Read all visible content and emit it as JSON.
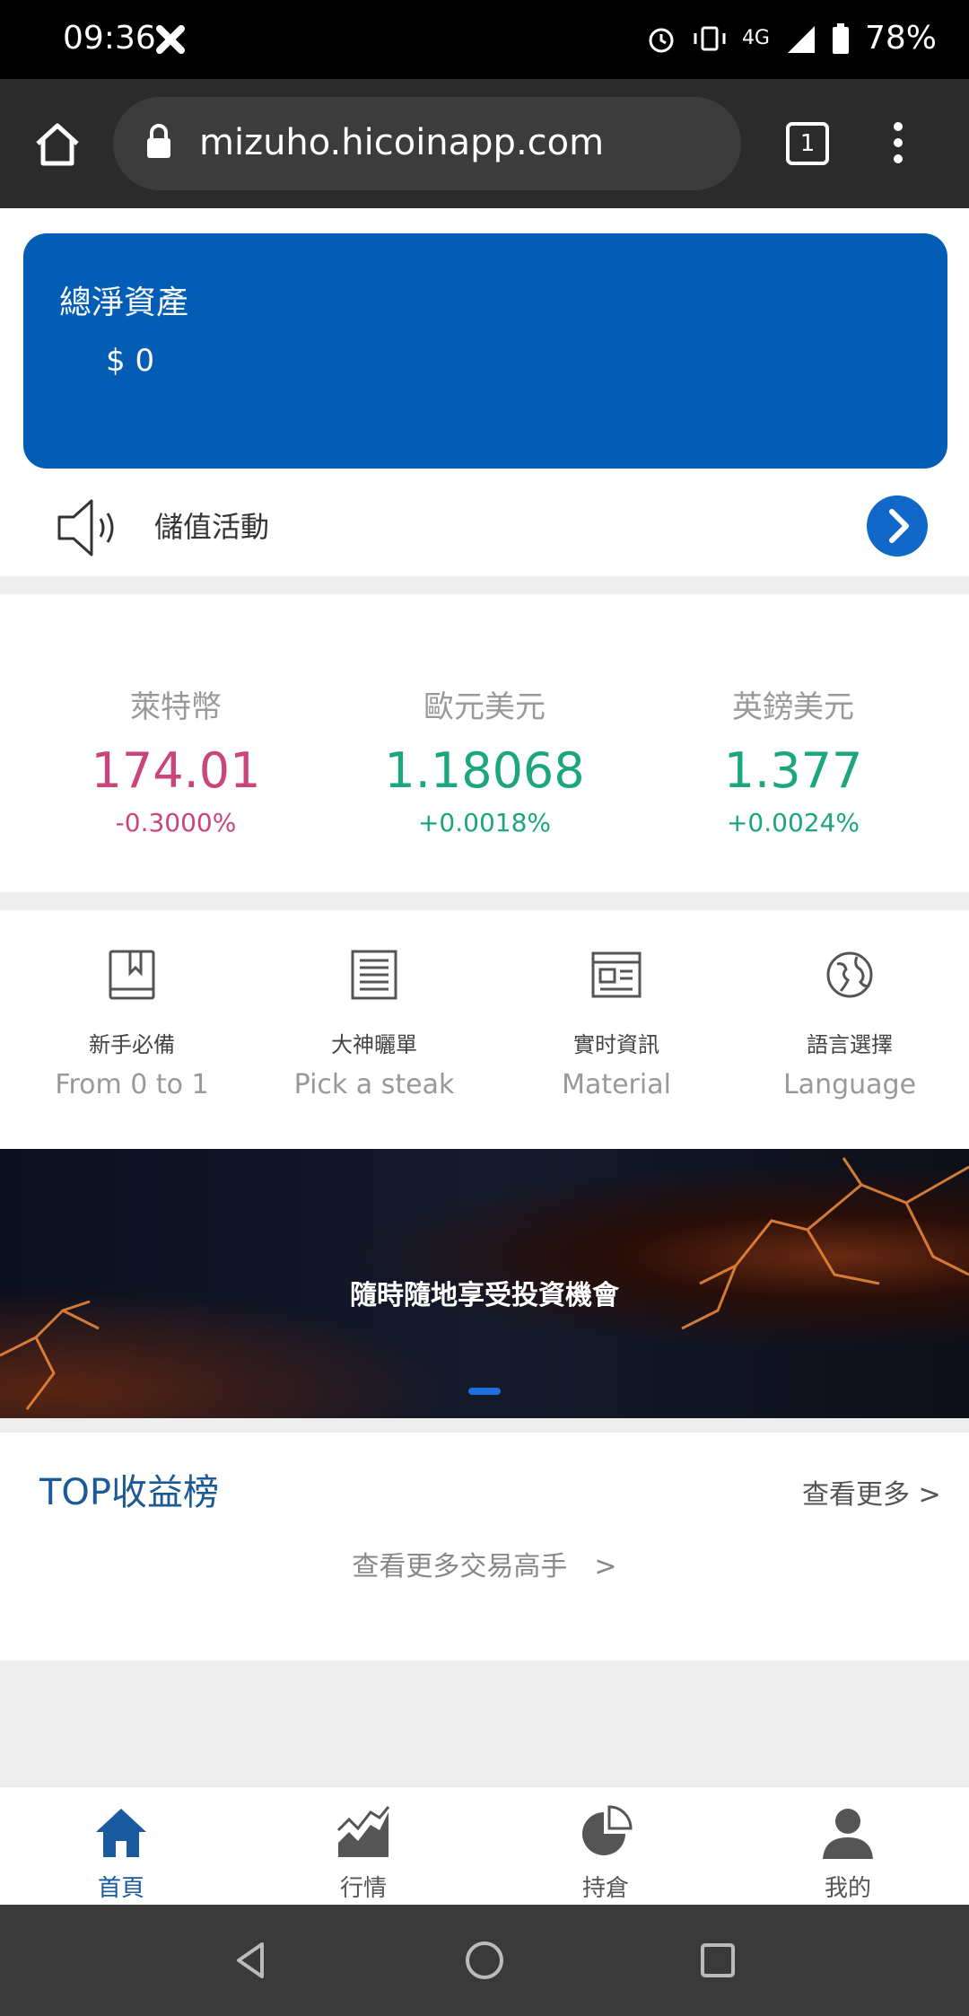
{
  "status_bar": {
    "time": "09:36",
    "network": "4G",
    "battery": "78%"
  },
  "browser": {
    "url": "mizuho.hicoinapp.com",
    "tab_count": "1"
  },
  "asset_card": {
    "label": "總淨資產",
    "value": "$ 0",
    "color": "#045db5"
  },
  "promo": {
    "text": "儲值活動"
  },
  "tickers": [
    {
      "name": "萊特幣",
      "price": "174.01",
      "change": "-0.3000%",
      "trend": "down"
    },
    {
      "name": "歐元美元",
      "price": "1.18068",
      "change": "+0.0018%",
      "trend": "up"
    },
    {
      "name": "英鎊美元",
      "price": "1.377",
      "change": "+0.0024%",
      "trend": "up"
    }
  ],
  "quick_menu": [
    {
      "zh": "新手必備",
      "en": "From 0 to 1",
      "icon": "book-icon"
    },
    {
      "zh": "大神曬單",
      "en": "Pick a steak",
      "icon": "list-document-icon"
    },
    {
      "zh": "實时資訊",
      "en": "Material",
      "icon": "news-window-icon"
    },
    {
      "zh": "語言選擇",
      "en": "Language",
      "icon": "globe-icon"
    }
  ],
  "banner": {
    "caption": "隨時隨地享受投資機會"
  },
  "top_earnings": {
    "title": "TOP收益榜",
    "more": "查看更多 >",
    "traders_link": "查看更多交易高手　>"
  },
  "bottom_nav": [
    {
      "label": "首頁",
      "icon": "home-icon",
      "active": true
    },
    {
      "label": "行情",
      "icon": "market-chart-icon",
      "active": false
    },
    {
      "label": "持倉",
      "icon": "pie-chart-icon",
      "active": false
    },
    {
      "label": "我的",
      "icon": "user-icon",
      "active": false
    }
  ],
  "colors": {
    "accent_blue": "#045db5",
    "down_red": "#c9457a",
    "up_green": "#1ba67e"
  }
}
